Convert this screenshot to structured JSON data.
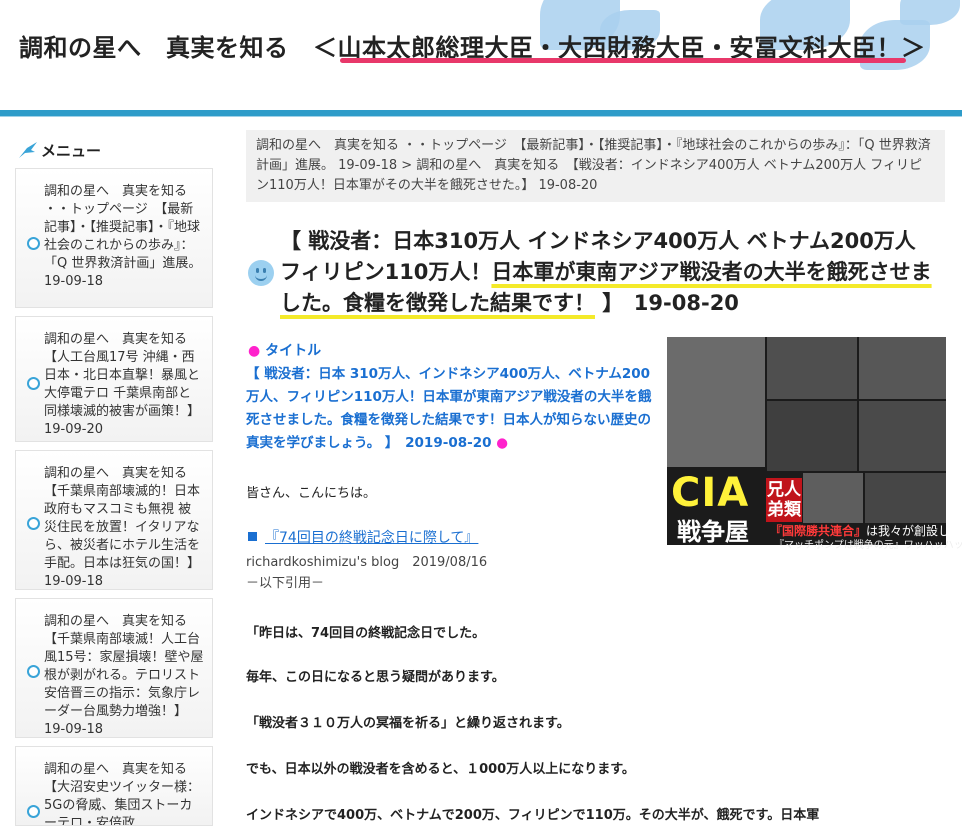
{
  "header": {
    "site_title": "調和の星へ　真実を知る　＜山本太郎総理大臣・大西財務大臣・安冨文科大臣！＞"
  },
  "sidebar": {
    "menu_label": "メニュー",
    "items": [
      {
        "text": "調和の星へ　真実を知る ・・トップページ　【最新記事】・【推奨記事】・『地球社会のこれからの歩み』：「Q 世界救済計画」進展。 19-09-18"
      },
      {
        "text": "調和の星へ　真実を知る　【人工台風17号 沖縄・西日本・北日本直撃！暴風と大停電テロ 千葉県南部と同様壊滅的被害が画策！】 19-09-20"
      },
      {
        "text": "調和の星へ　真実を知る　【千葉県南部壊滅的！日本政府もマスコミも無視 被災住民を放置！イタリアなら、被災者にホテル生活を手配。日本は狂気の国！】 19-09-18"
      },
      {
        "text": "調和の星へ　真実を知る　【千葉県南部壊滅！人工台風15号：家屋損壊！壁や屋根が剥がれる。テロリスト安倍晋三の指示：気象庁レーダー台風勢力増強！】 19-09-18"
      },
      {
        "text": "調和の星へ　真実を知る　【大沼安史ツイッター様：5Gの脅威、集団ストーカーテロ・安倍政"
      }
    ]
  },
  "breadcrumb": {
    "text": "調和の星へ　真実を知る ・・トップページ　【最新記事】・【推奨記事】・『地球社会のこれからの歩み』：「Q 世界救済計画」進展。 19-09-18 > 調和の星へ　真実を知る　【戦没者：インドネシア400万人 ベトナム200万人 フィリピン110万人！日本軍がその大半を餓死させた。】 19-08-20"
  },
  "post": {
    "title_pre": "【 戦没者：日本310万人 インドネシア400万人 ベトナム200万人 フィリピン110万人！",
    "title_hl": "日本軍が東南アジア戦没者の大半を餓死させました。食糧を徴発した結果です！",
    "title_post": " 】　19-08-20",
    "section_label": "タイトル",
    "summary": "【 戦没者：日本 310万人、インドネシア400万人、ベトナム200万人、フィリピン110万人！日本軍が東南アジア戦没者の大半を餓死させました。食糧を徴発した結果です！日本人が知らない歴史の真実を学びましょう。 】　2019-08-20",
    "greeting": "皆さん、こんにちは。",
    "link_text": "『74回目の終戦記念日に際して』",
    "blog_line": "richardkoshimizu's blog　2019/08/16",
    "quote_intro": "－以下引用－",
    "paragraphs": [
      "「昨日は、74回目の終戦記念日でした。",
      "毎年、この日になると思う疑問があります。",
      "「戦没者３１０万人の冥福を祈る」と繰り返されます。",
      "でも、日本以外の戦没者を含めると、１000万人以上になります。",
      "インドネシアで400万、ベトナムで200万、フィリピンで110万。その大半が、餓死です。日本軍"
    ]
  },
  "photo": {
    "cia": "CIA",
    "sensoya": "戦争屋",
    "kyoudai": "兄人弟類",
    "rengou_red": "『国際勝共連合』",
    "rengou_rest": "は我々が創設した",
    "pump": "『マッチポンプは戦争の元』ワッハッハッ。"
  },
  "colors": {
    "accent_blue": "#2e9cc9",
    "link_blue": "#1a6fd1",
    "title_underline": "#e8386a",
    "highlight_yellow": "#f4ea2a"
  }
}
